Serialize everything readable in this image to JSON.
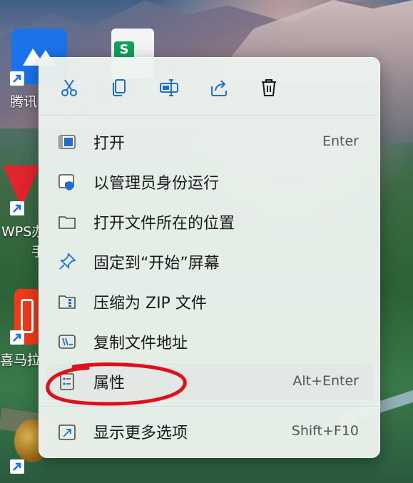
{
  "desktop": {
    "icons": [
      {
        "name": "tencent-meeting",
        "label": "腾讯"
      },
      {
        "name": "wps-office",
        "label": "WPS办",
        "label2": "手"
      },
      {
        "name": "ximalaya",
        "label": "喜马拉"
      }
    ]
  },
  "context_menu": {
    "toolbar": [
      {
        "name": "cut",
        "icon": "scissors-icon"
      },
      {
        "name": "copy",
        "icon": "copy-icon"
      },
      {
        "name": "rename",
        "icon": "rename-icon"
      },
      {
        "name": "share",
        "icon": "share-icon"
      },
      {
        "name": "delete",
        "icon": "trash-icon"
      }
    ],
    "items": [
      {
        "label": "打开",
        "accelerator": "Enter",
        "icon": "open-window-icon"
      },
      {
        "label": "以管理员身份运行",
        "accelerator": "",
        "icon": "admin-shield-icon"
      },
      {
        "label": "打开文件所在的位置",
        "accelerator": "",
        "icon": "folder-icon"
      },
      {
        "label": "固定到“开始”屏幕",
        "accelerator": "",
        "icon": "pin-icon"
      },
      {
        "label": "压缩为 ZIP 文件",
        "accelerator": "",
        "icon": "zip-folder-icon"
      },
      {
        "label": "复制文件地址",
        "accelerator": "",
        "icon": "copy-path-icon"
      },
      {
        "label": "属性",
        "accelerator": "Alt+Enter",
        "icon": "properties-icon",
        "highlighted": true
      },
      {
        "label": "显示更多选项",
        "accelerator": "Shift+F10",
        "icon": "more-options-icon"
      }
    ]
  },
  "colors": {
    "accent": "#1a6fd1",
    "annotation": "#e0101a",
    "menu_bg": "#ecf2ee"
  }
}
